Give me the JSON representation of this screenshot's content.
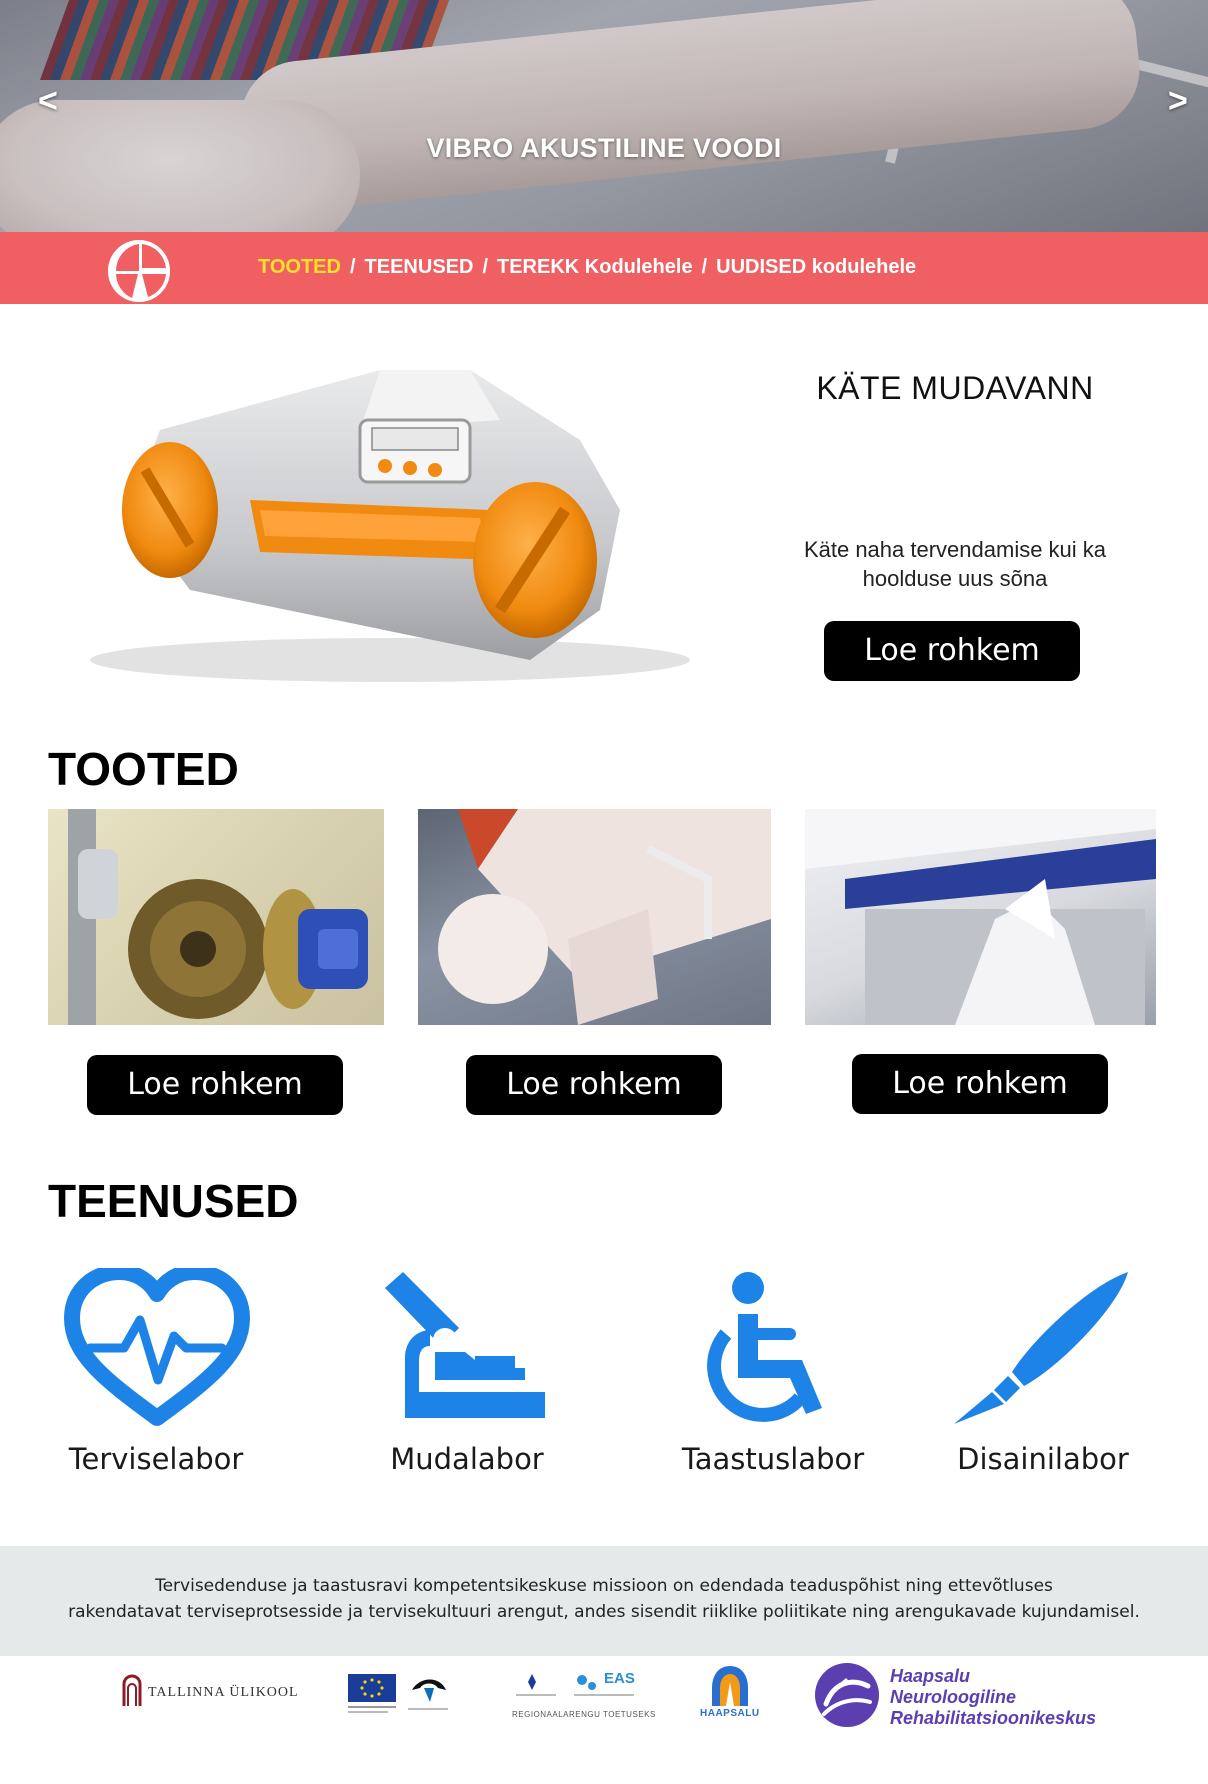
{
  "hero": {
    "title": "VIBRO AKUSTILINE VOODI",
    "prev_label": "<",
    "next_label": ">"
  },
  "nav": {
    "items": [
      {
        "label": "TOOTED",
        "active": true
      },
      {
        "label": "TEENUSED",
        "active": false
      },
      {
        "label": "TEREKK Kodulehele",
        "active": false
      },
      {
        "label": "UUDISED kodulehele",
        "active": false
      }
    ],
    "separator": "/",
    "colors": {
      "bar": "#f05f62",
      "active": "#ffe227",
      "text": "#ffffff"
    }
  },
  "feature": {
    "title": "KÄTE MUDAVANN",
    "description": "Käte naha tervendamise kui ka hoolduse uus sõna",
    "button": "Loe rohkem"
  },
  "tooted": {
    "title": "TOOTED",
    "products": [
      {
        "button": "Loe rohkem"
      },
      {
        "button": "Loe rohkem"
      },
      {
        "button": "Loe rohkem"
      }
    ]
  },
  "teenused": {
    "title": "TEENUSED",
    "services": [
      {
        "label": "Terviselabor",
        "icon": "heart-pulse-icon"
      },
      {
        "label": "Mudalabor",
        "icon": "microscope-icon"
      },
      {
        "label": "Taastuslabor",
        "icon": "wheelchair-icon"
      },
      {
        "label": "Disainilabor",
        "icon": "scalpel-icon"
      }
    ],
    "icon_color": "#1e83e6"
  },
  "footer": {
    "mission_line1": "Tervisedenduse ja taastusravi kompetentsikeskuse missioon on edendada teaduspõhist ning ettevõtluses",
    "mission_line2": "rakendatavat terviseprotsesside ja tervisekultuuri arengut, andes sisendit riiklike poliitikate ning arengukavade kujundamisel.",
    "partners": {
      "tlu": "TALLINNA ÜLIKOOL",
      "eas": "EAS",
      "regional": "REGIONAALARENGU TOETUSEKS",
      "haapsalu": "HAAPSALU",
      "hnrk_line1": "Haapsalu",
      "hnrk_line2": "Neuroloogiline",
      "hnrk_line3": "Rehabilitatsioonikeskus"
    }
  }
}
